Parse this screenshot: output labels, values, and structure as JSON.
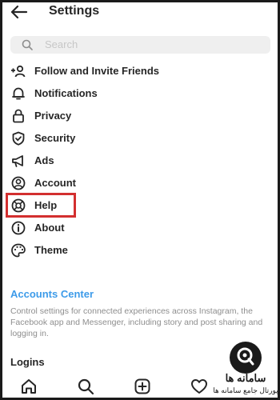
{
  "header": {
    "title": "Settings",
    "back_icon": "arrow-left-icon"
  },
  "search": {
    "placeholder": "Search",
    "icon": "search-icon"
  },
  "menu": [
    {
      "label": "Follow and Invite Friends",
      "icon": "add-person-icon"
    },
    {
      "label": "Notifications",
      "icon": "bell-icon"
    },
    {
      "label": "Privacy",
      "icon": "lock-icon"
    },
    {
      "label": "Security",
      "icon": "shield-check-icon"
    },
    {
      "label": "Ads",
      "icon": "megaphone-icon"
    },
    {
      "label": "Account",
      "icon": "person-circle-icon"
    },
    {
      "label": "Help",
      "icon": "lifebuoy-icon",
      "highlighted": true
    },
    {
      "label": "About",
      "icon": "info-icon"
    },
    {
      "label": "Theme",
      "icon": "palette-icon"
    }
  ],
  "accounts_center": {
    "title": "Accounts Center",
    "description": "Control settings for connected experiences across Instagram, the Facebook app and Messenger, including story and post sharing and logging in."
  },
  "logins": {
    "title": "Logins"
  },
  "bottom_nav": [
    "home-icon",
    "search-icon",
    "add-post-icon",
    "heart-icon"
  ],
  "watermark": {
    "text": "سامانه ها",
    "subtext": "پورتال جامع سامانه ها"
  },
  "colors": {
    "accent_link": "#3d9be9",
    "highlight_box": "#d32f2f",
    "text": "#262626",
    "muted": "#8e8e8e"
  }
}
